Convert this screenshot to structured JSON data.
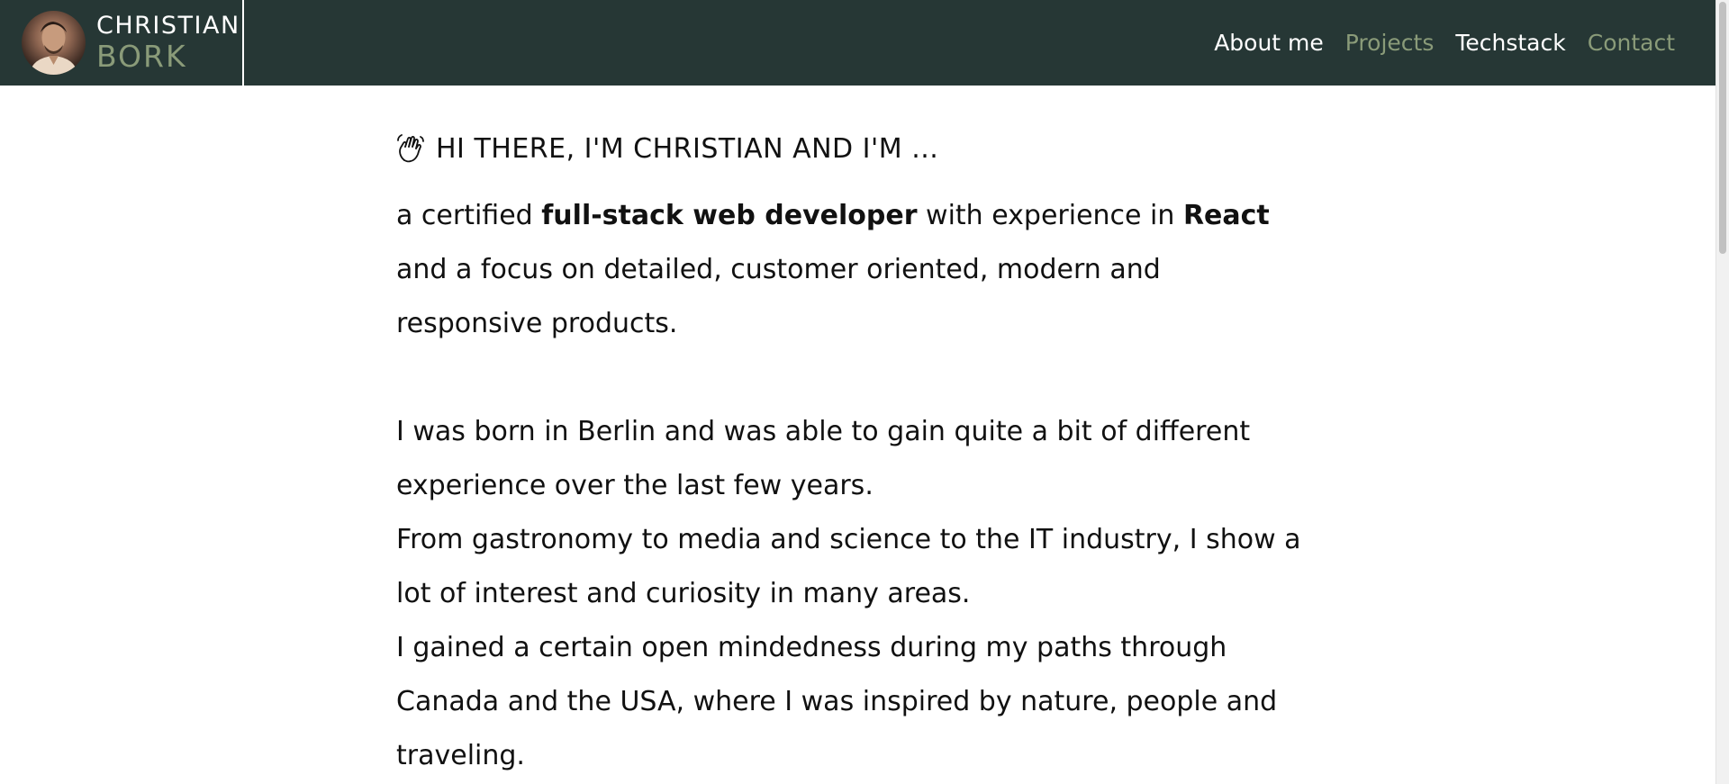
{
  "brand": {
    "first_name": "CHRISTIAN",
    "last_name": "BORK"
  },
  "nav": {
    "items": [
      {
        "label": "About me",
        "state": "active"
      },
      {
        "label": "Projects",
        "state": "muted"
      },
      {
        "label": "Techstack",
        "state": "active"
      },
      {
        "label": "Contact",
        "state": "muted"
      }
    ]
  },
  "intro": {
    "greeting": "HI THERE, I'M CHRISTIAN AND I'M ...",
    "line1_pre": "a certified ",
    "line1_role": "full-stack web developer",
    "line1_mid": " with experience in ",
    "line1_tech": "React",
    "line1_post": " and a focus on detailed, customer oriented, modern and responsive products."
  },
  "bio": {
    "p1": "I was born in Berlin and was able to gain quite a bit of different experience over the last few years.",
    "p2": "From gastronomy to media and science to the IT industry, I show a lot of interest and curiosity in many areas.",
    "p3": "I gained a certain open mindedness during my paths through Canada and the USA, where I was inspired by nature, people and traveling."
  },
  "colors": {
    "header_bg": "#263735",
    "accent_muted": "#8a9b79",
    "text": "#111111"
  },
  "icons": {
    "greeting": "waving-hand-icon"
  }
}
